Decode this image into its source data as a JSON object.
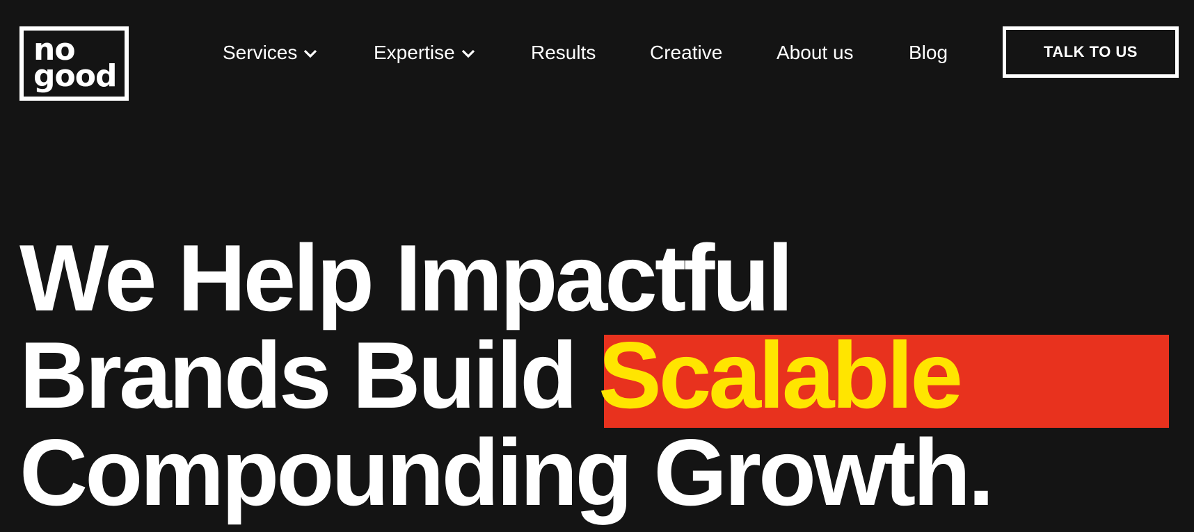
{
  "brand": {
    "logo_line1": "no",
    "logo_line2": "good"
  },
  "nav": {
    "items": [
      {
        "label": "Services",
        "has_dropdown": true,
        "icon": "chevron-down-icon"
      },
      {
        "label": "Expertise",
        "has_dropdown": true,
        "icon": "chevron-down-icon"
      },
      {
        "label": "Results",
        "has_dropdown": false
      },
      {
        "label": "Creative",
        "has_dropdown": false
      },
      {
        "label": "About us",
        "has_dropdown": false
      },
      {
        "label": "Blog",
        "has_dropdown": false
      }
    ],
    "cta_label": "TALK TO US"
  },
  "hero": {
    "line1": "We Help Impactful",
    "line2_prefix": "Brands Build ",
    "line2_highlight": "Scalable",
    "line3": "Compounding Growth."
  },
  "colors": {
    "background": "#141414",
    "text": "#ffffff",
    "highlight_bg": "#e8321e",
    "highlight_text": "#ffe500"
  }
}
